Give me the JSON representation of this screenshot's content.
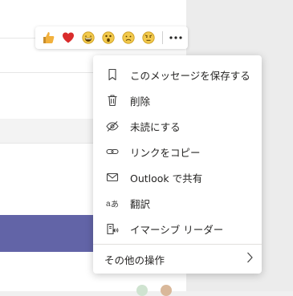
{
  "reactions": [
    {
      "name": "like",
      "icon": "thumbs-up-icon"
    },
    {
      "name": "heart",
      "icon": "heart-icon"
    },
    {
      "name": "laugh",
      "icon": "laugh-icon"
    },
    {
      "name": "surprised",
      "icon": "surprised-icon"
    },
    {
      "name": "sad",
      "icon": "sad-icon"
    },
    {
      "name": "angry",
      "icon": "angry-icon"
    }
  ],
  "more_options_icon": "more-options-icon",
  "menu": {
    "items": [
      {
        "label": "このメッセージを保存する",
        "icon": "bookmark-icon"
      },
      {
        "label": "削除",
        "icon": "delete-icon"
      },
      {
        "label": "未読にする",
        "icon": "mark-unread-icon"
      },
      {
        "label": "リンクをコピー",
        "icon": "link-icon"
      },
      {
        "label": "Outlook で共有",
        "icon": "mail-icon"
      },
      {
        "label": "翻訳",
        "icon": "translate-icon"
      },
      {
        "label": "イマーシブ リーダー",
        "icon": "immersive-reader-icon"
      }
    ],
    "more_actions_label": "その他の操作"
  },
  "colors": {
    "accent": "#6264a7",
    "like": "#e8a33d",
    "heart": "#d92c2c",
    "emoji": "#f2c94c"
  }
}
